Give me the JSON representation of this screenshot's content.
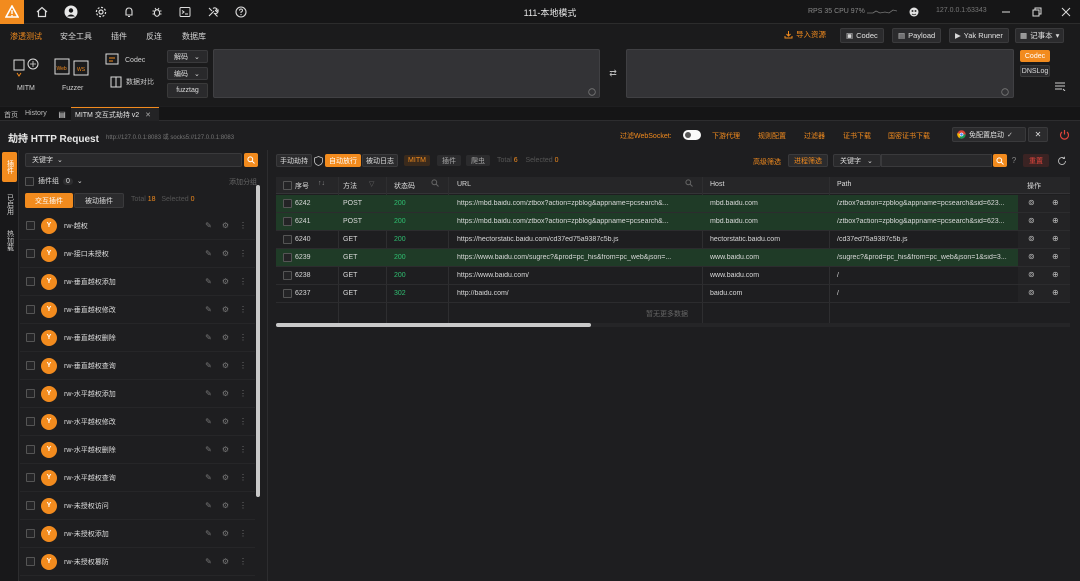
{
  "window": {
    "title": "111-本地模式",
    "stats": "RPS 35  CPU 97%",
    "ip": "127.0.0.1:63343"
  },
  "menu": [
    "渗透测试",
    "安全工具",
    "插件",
    "反连",
    "数据库"
  ],
  "top_buttons": {
    "import": "导入资源",
    "codec": "Codec",
    "payload": "Payload",
    "yak_runner": "Yak Runner",
    "notebook": "记事本"
  },
  "tools": {
    "mitm": "MITM",
    "fuzzer": "Fuzzer",
    "codec": "Codec",
    "compare": "数据对比",
    "decode": "解码",
    "encode": "编码",
    "fuzztag": "fuzztag",
    "codec_side": "Codec",
    "dnslog": "DNSLog"
  },
  "tabs": {
    "home": "首页",
    "history": "History",
    "mitm": "MITM 交互式劫持 v2"
  },
  "header": {
    "title": "劫持 HTTP Request",
    "subtitle": "http://127.0.0.1:8083 或 socks5://127.0.0.1:8083",
    "filter_ws": "过滤WebSocket:",
    "downstream": "下游代理",
    "rules": "规则配置",
    "filter": "过滤器",
    "cert": "证书下载",
    "gm_cert": "国密证书下载",
    "start_free": "免配置启动"
  },
  "rail": [
    "插件",
    "已启用",
    "热加载"
  ],
  "plugins": {
    "keyword": "关键字",
    "group": "插件组",
    "group_count": "0",
    "add_group": "添加分组",
    "tab_interactive": "交互插件",
    "tab_passive": "被动插件",
    "total_label": "Total",
    "total": "18",
    "selected_label": "Selected",
    "selected": "0",
    "items": [
      "rw-越权",
      "rw-接口未授权",
      "rw-垂直越权添加",
      "rw-垂直越权修改",
      "rw-垂直越权删除",
      "rw-垂直越权查询",
      "rw-水平越权添加",
      "rw-水平越权修改",
      "rw-水平越权删除",
      "rw-水平越权查询",
      "rw-未授权访问",
      "rw-未授权添加",
      "rw-未授权篡防"
    ]
  },
  "toolbar": {
    "manual": "手动劫持",
    "auto": "自动放行",
    "passive_log": "被动日志",
    "mitm": "MITM",
    "plugin": "插件",
    "crawler": "爬虫",
    "total_label": "Total",
    "total": "6",
    "selected_label": "Selected",
    "selected": "0",
    "adv_filter": "高级筛选",
    "proc_filter": "进程筛选",
    "keyword": "关键字",
    "reset": "重置"
  },
  "columns": [
    "序号",
    "方法",
    "状态码",
    "URL",
    "Host",
    "Path",
    "操作"
  ],
  "rows": [
    {
      "id": "6242",
      "method": "POST",
      "status": "200",
      "url": "https://mbd.baidu.com/ztbox?action=zpblog&appname=pcsearch&...",
      "host": "mbd.baidu.com",
      "path": "/ztbox?action=zpblog&appname=pcsearch&sid=623...",
      "green": true
    },
    {
      "id": "6241",
      "method": "POST",
      "status": "200",
      "url": "https://mbd.baidu.com/ztbox?action=zpblog&appname=pcsearch&...",
      "host": "mbd.baidu.com",
      "path": "/ztbox?action=zpblog&appname=pcsearch&sid=623...",
      "green": true
    },
    {
      "id": "6240",
      "method": "GET",
      "status": "200",
      "url": "https://hectorstatic.baidu.com/cd37ed75a9387c5b.js",
      "host": "hectorstatic.baidu.com",
      "path": "/cd37ed75a9387c5b.js",
      "green": false
    },
    {
      "id": "6239",
      "method": "GET",
      "status": "200",
      "url": "https://www.baidu.com/sugrec?&prod=pc_his&from=pc_web&json=...",
      "host": "www.baidu.com",
      "path": "/sugrec?&prod=pc_his&from=pc_web&json=1&sid=3...",
      "green": true
    },
    {
      "id": "6238",
      "method": "GET",
      "status": "200",
      "url": "https://www.baidu.com/",
      "host": "www.baidu.com",
      "path": "/",
      "green": false
    },
    {
      "id": "6237",
      "method": "GET",
      "status": "302",
      "url": "http://baidu.com/",
      "host": "baidu.com",
      "path": "/",
      "green": false
    }
  ],
  "no_more": "暂无更多数据",
  "colors": {
    "accent": "#f28b1e",
    "green_row": "#1f3b27",
    "status_ok": "#2fbf71"
  }
}
